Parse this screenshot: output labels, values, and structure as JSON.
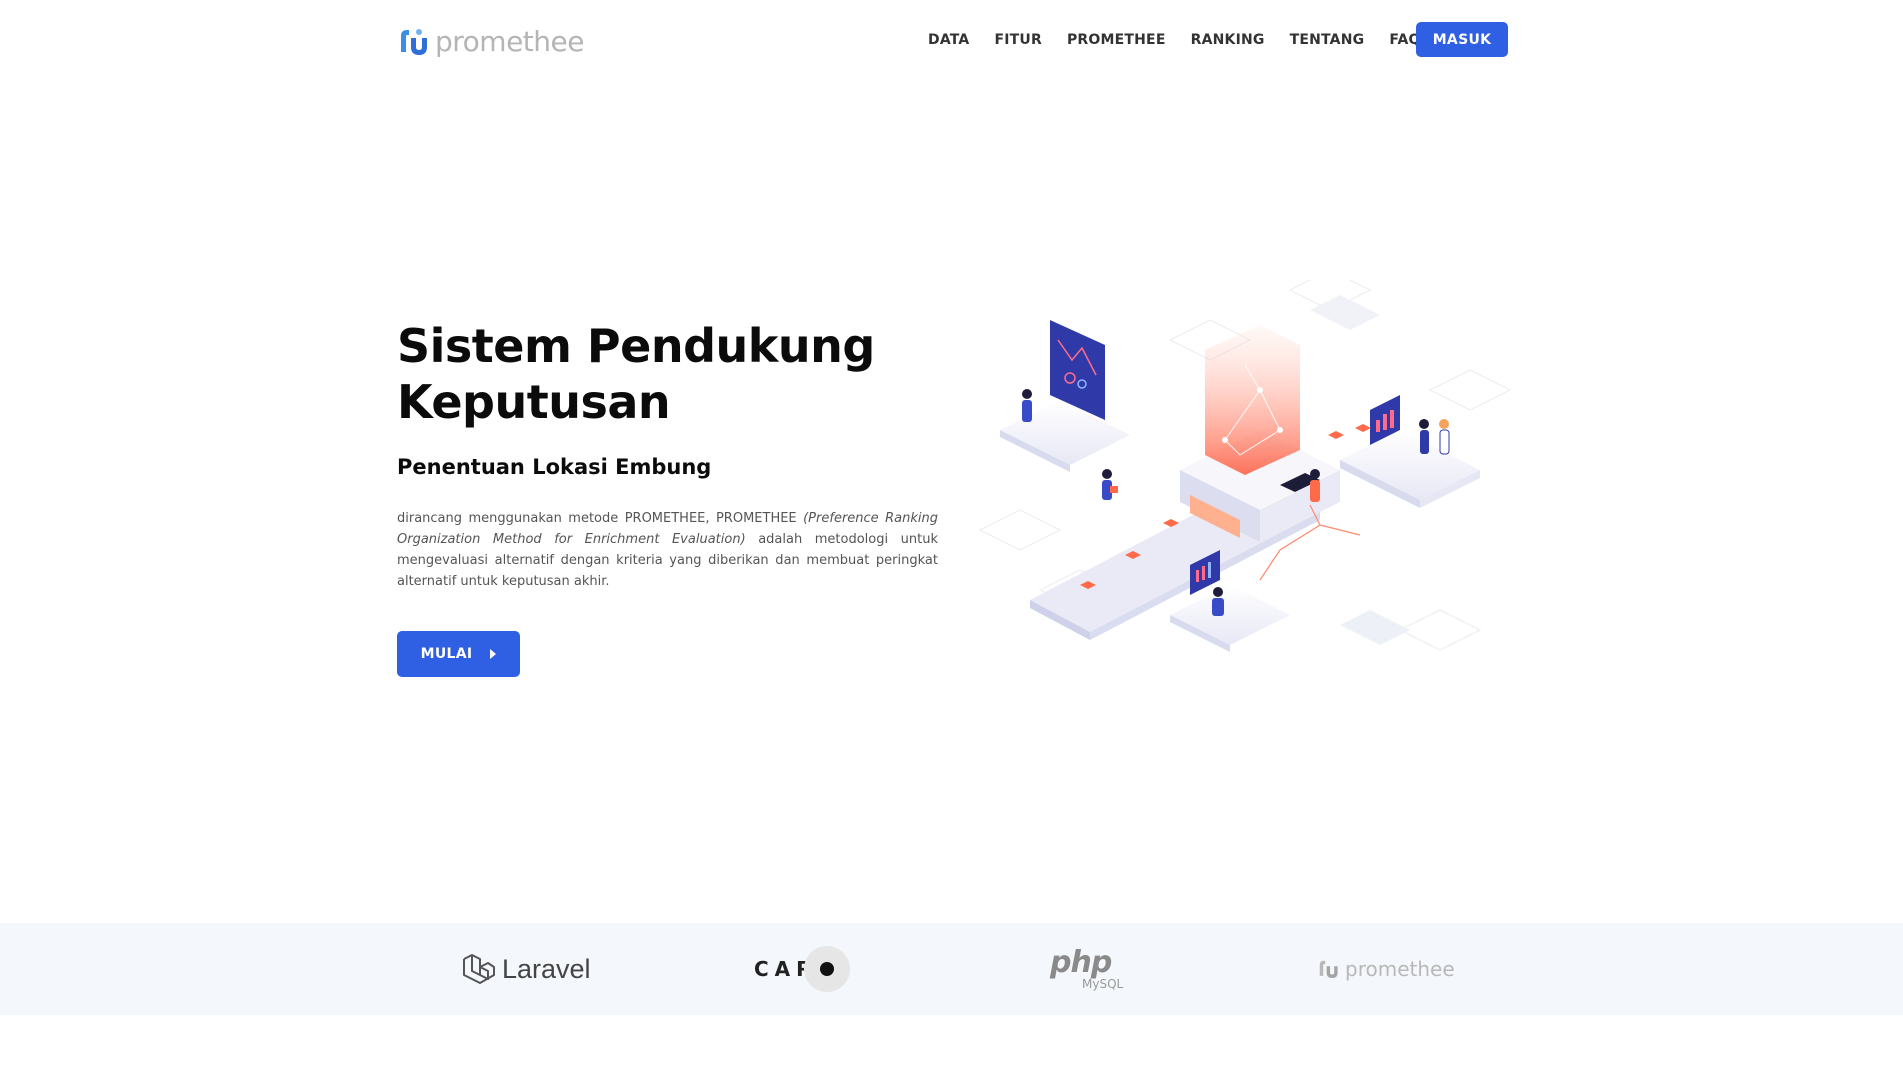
{
  "brand": {
    "name": "promethee"
  },
  "nav": {
    "items": [
      {
        "label": "DATA"
      },
      {
        "label": "FITUR"
      },
      {
        "label": "PROMETHEE"
      },
      {
        "label": "RANKING"
      },
      {
        "label": "TENTANG"
      },
      {
        "label": "FAQ"
      }
    ],
    "login_label": "MASUK"
  },
  "hero": {
    "title": "Sistem Pendukung Keputusan",
    "subtitle": "Penentuan Lokasi Embung",
    "desc_pre": "dirancang menggunakan metode PROMETHEE, PROMETHEE ",
    "desc_italic": "(Preference Ranking Organization Method for Enrichment Evaluation)",
    "desc_post": " adalah metodologi untuk mengevaluasi alternatif dengan kriteria yang diberikan dan membuat peringkat alternatif untuk keputusan akhir.",
    "cta_label": "MULAI"
  },
  "partners": {
    "laravel": "Laravel",
    "carto": "CART",
    "php": "php",
    "php_sub": "MySQL",
    "promethee": "promethee"
  },
  "colors": {
    "primary": "#2f5fe3",
    "strip_bg": "#f4f7fb",
    "accent_orange": "#ff6b4a"
  },
  "icons": {
    "brand_logo": "promethee-logo-icon",
    "cta": "caret-right-icon",
    "laravel": "laravel-logo-icon"
  }
}
